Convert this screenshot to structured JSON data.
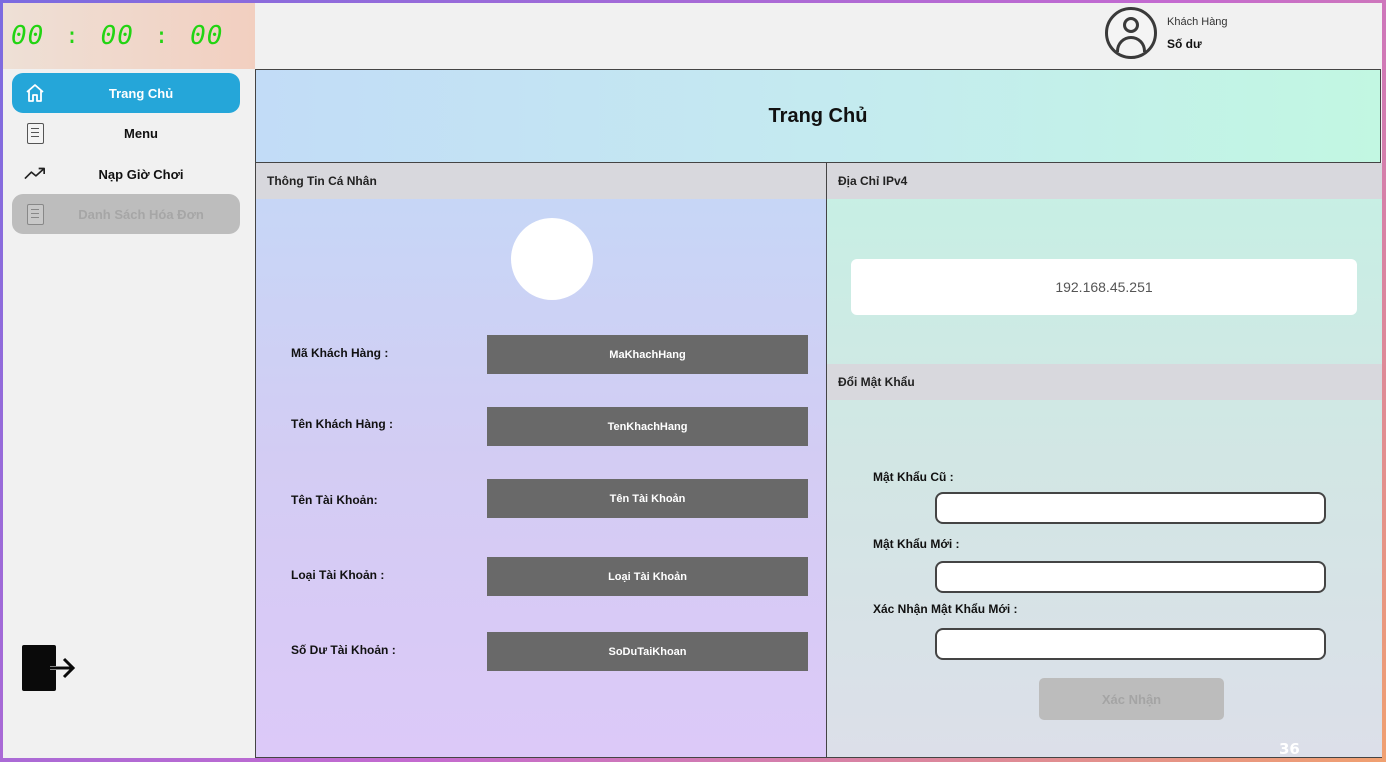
{
  "clock": {
    "hours": "00",
    "minutes": "00",
    "seconds": "00",
    "separator": ":"
  },
  "user": {
    "role": "Khách Hàng",
    "balance_label": "Số dư",
    "icon": "user-circle-icon"
  },
  "sidebar": {
    "items": [
      {
        "label": "Trang Chủ",
        "icon": "home-icon",
        "state": "active"
      },
      {
        "label": "Menu",
        "icon": "document-icon",
        "state": "normal"
      },
      {
        "label": "Nạp Giờ Chơi",
        "icon": "trending-up-icon",
        "state": "normal"
      },
      {
        "label": "Danh Sách Hóa Đơn",
        "icon": "document-icon",
        "state": "disabled"
      }
    ],
    "logout_icon": "logout-icon"
  },
  "header": {
    "title": "Trang Chủ"
  },
  "profile": {
    "section_title": "Thông Tin Cá Nhân",
    "fields": [
      {
        "label": "Mã Khách Hàng :",
        "value": "MaKhachHang"
      },
      {
        "label": "Tên Khách Hàng :",
        "value": "TenKhachHang"
      },
      {
        "label": "Tên Tài Khoản:",
        "value": "Tên Tài Khoản"
      },
      {
        "label": "Loại Tài Khoản :",
        "value": "Loại Tài Khoản"
      },
      {
        "label": "Số Dư Tài Khoản :",
        "value": "SoDuTaiKhoan"
      }
    ]
  },
  "ipv4": {
    "section_title": "Địa Chỉ IPv4",
    "value": "192.168.45.251"
  },
  "password": {
    "section_title": "Đổi Mật Khẩu",
    "old_label": "Mật Khẩu Cũ :",
    "new_label": "Mật Khẩu Mới :",
    "confirm_label": "Xác Nhận Mật Khẩu Mới :",
    "old_value": "",
    "new_value": "",
    "confirm_value": "",
    "submit_label": "Xác Nhận"
  },
  "page_number": "36",
  "colors": {
    "accent": "#25a6d9",
    "clock": "#22d412",
    "value_box": "#696969"
  }
}
